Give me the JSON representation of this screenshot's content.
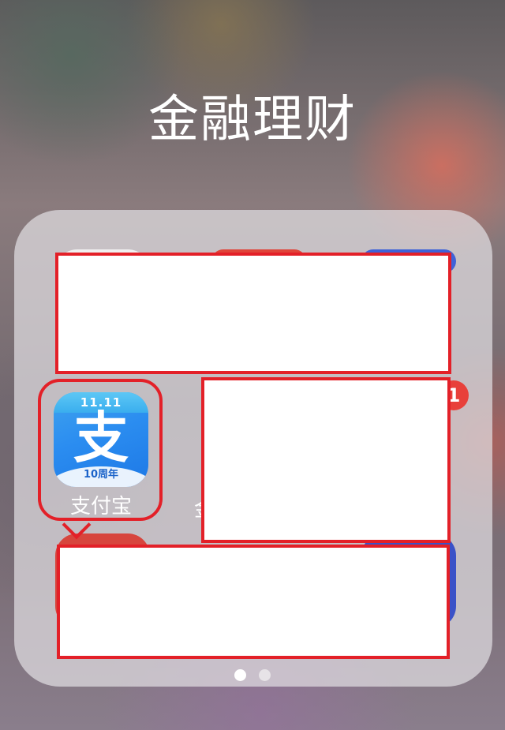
{
  "folder": {
    "title": "金融理财",
    "pages": 2,
    "current_page": 1
  },
  "apps": [
    {
      "label": "支付宝",
      "icon": "alipay-icon",
      "icon_glyph": "支",
      "icon_badge_text": "11.11",
      "icon_sub_text": "10周年",
      "highlighted": true
    }
  ],
  "partial_label": "金",
  "notification_badge": "1",
  "colors": {
    "alipay_blue": "#1d78e6",
    "highlight_red": "#e32028",
    "badge_red": "#e8403a"
  }
}
